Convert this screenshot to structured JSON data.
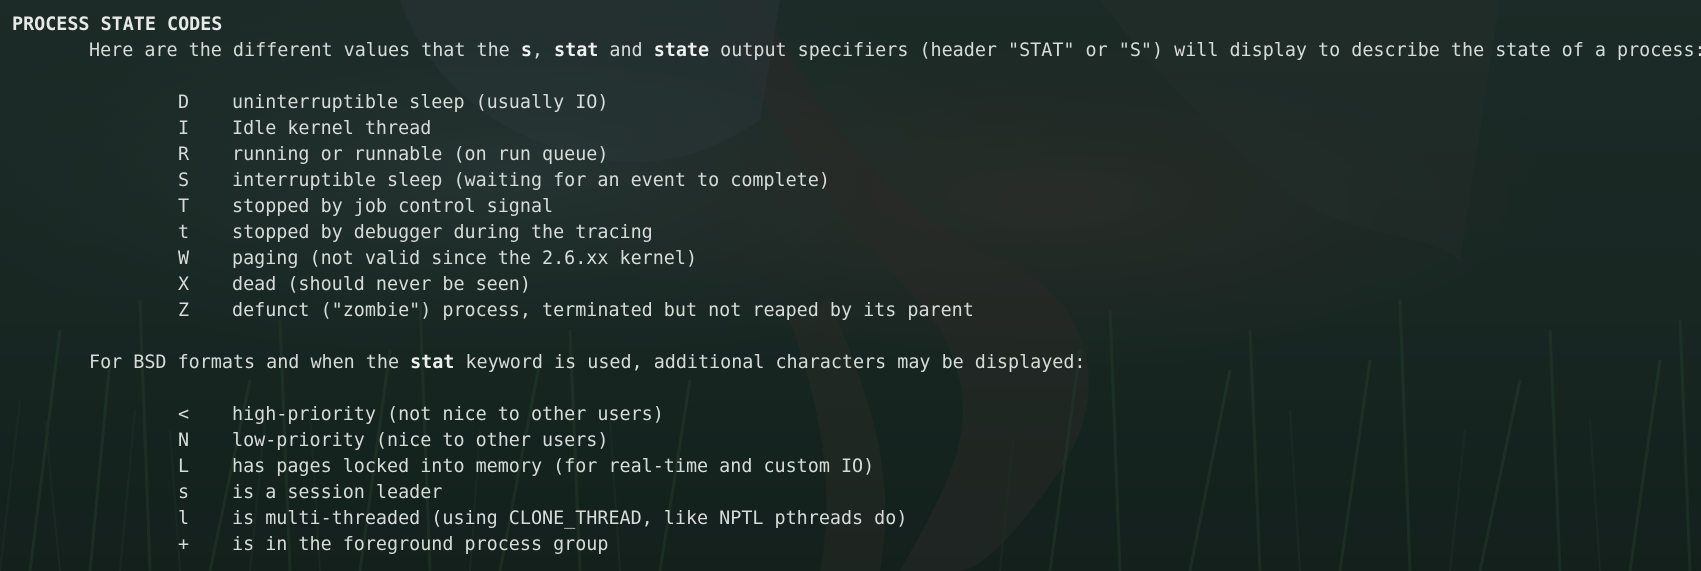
{
  "colors": {
    "background": "#1c2b27",
    "text": "#d8dcd9"
  },
  "manpage": {
    "section_title": "PROCESS STATE CODES",
    "intro": {
      "p1": "Here are the different values that the ",
      "s": "s",
      "p2": ", ",
      "stat": "stat",
      "p3": " and ",
      "state": "state",
      "p4": " output specifiers (header \"STAT\" or \"S\") will display to describe the state of a process:"
    },
    "state_codes": [
      {
        "code": "D",
        "desc": "uninterruptible sleep (usually IO)"
      },
      {
        "code": "I",
        "desc": "Idle kernel thread"
      },
      {
        "code": "R",
        "desc": "running or runnable (on run queue)"
      },
      {
        "code": "S",
        "desc": "interruptible sleep (waiting for an event to complete)"
      },
      {
        "code": "T",
        "desc": "stopped by job control signal"
      },
      {
        "code": "t",
        "desc": "stopped by debugger during the tracing"
      },
      {
        "code": "W",
        "desc": "paging (not valid since the 2.6.xx kernel)"
      },
      {
        "code": "X",
        "desc": "dead (should never be seen)"
      },
      {
        "code": "Z",
        "desc": "defunct (\"zombie\") process, terminated but not reaped by its parent"
      }
    ],
    "bsd_intro": {
      "p1": "For BSD formats and when the ",
      "stat": "stat",
      "p2": " keyword is used, additional characters may be displayed:"
    },
    "bsd_codes": [
      {
        "code": "<",
        "desc": "high-priority (not nice to other users)"
      },
      {
        "code": "N",
        "desc": "low-priority (nice to other users)"
      },
      {
        "code": "L",
        "desc": "has pages locked into memory (for real-time and custom IO)"
      },
      {
        "code": "s",
        "desc": "is a session leader"
      },
      {
        "code": "l",
        "desc": "is multi-threaded (using CLONE_THREAD, like NPTL pthreads do)"
      },
      {
        "code": "+",
        "desc": "is in the foreground process group"
      }
    ]
  }
}
